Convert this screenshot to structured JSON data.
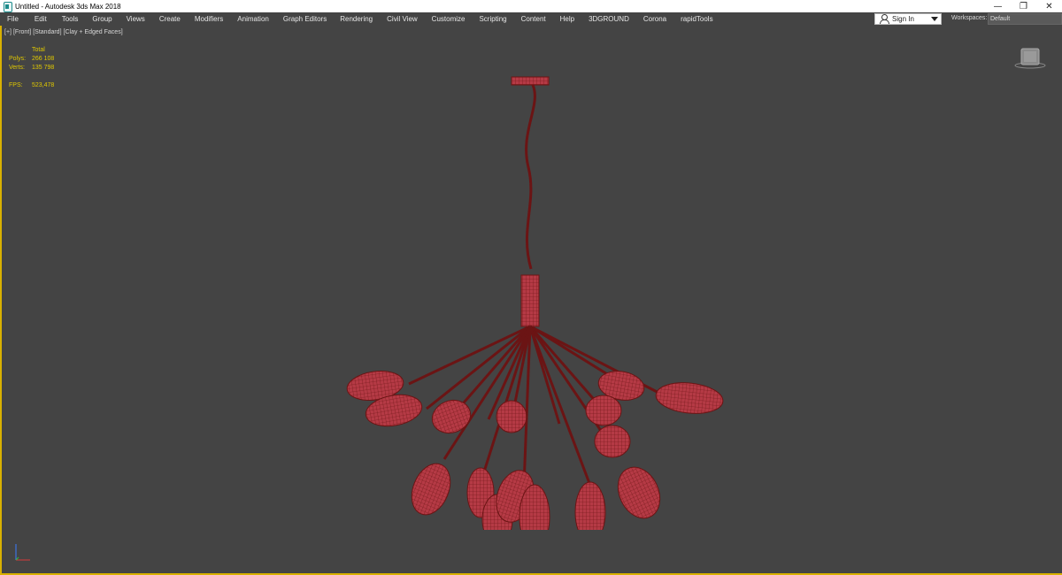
{
  "titlebar": {
    "title": "Untitled - Autodesk 3ds Max 2018",
    "minimize": "—",
    "restore": "❐",
    "close": "✕"
  },
  "menu": {
    "items": [
      "File",
      "Edit",
      "Tools",
      "Group",
      "Views",
      "Create",
      "Modifiers",
      "Animation",
      "Graph Editors",
      "Rendering",
      "Civil View",
      "Customize",
      "Scripting",
      "Content",
      "Help",
      "3DGROUND",
      "Corona",
      "rapidTools"
    ]
  },
  "account": {
    "signin": "Sign In",
    "workspaces_label": "Workspaces:",
    "workspace_value": "Default"
  },
  "viewport": {
    "label_parts": [
      "[+]",
      "[Front]",
      "[Standard]",
      "[Clay + Edged Faces]"
    ],
    "stats": {
      "header": "Total",
      "polys_label": "Polys:",
      "polys_value": "266 108",
      "verts_label": "Verts:",
      "verts_value": "135 798",
      "fps_label": "FPS:",
      "fps_value": "523,478"
    },
    "colors": {
      "wireframe": "#6b1414",
      "surface": "#b53a45",
      "stats_text": "#e0c800",
      "active_border": "#d9b100"
    },
    "icons": [
      "viewcube-icon",
      "axis-tripod-icon",
      "user-icon"
    ]
  }
}
